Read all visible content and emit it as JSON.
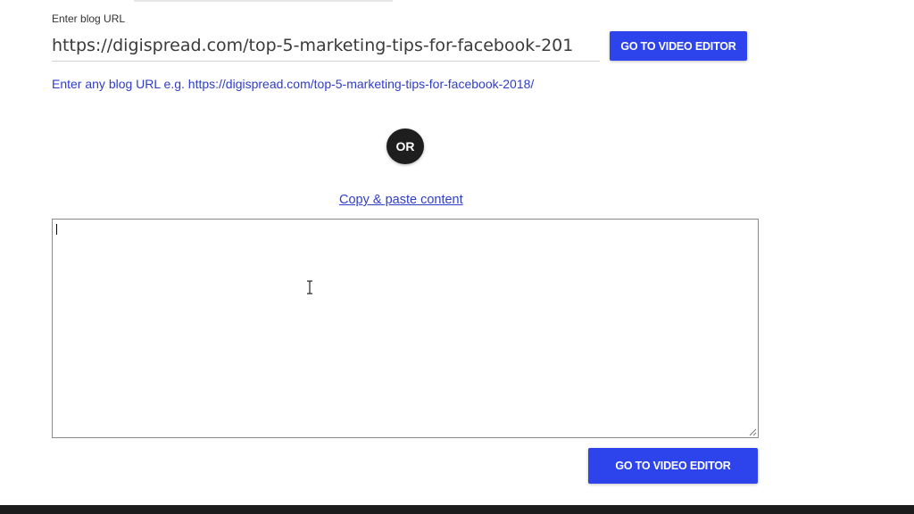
{
  "url_section": {
    "label": "Enter blog URL",
    "value": "https://digispread.com/top-5-marketing-tips-for-facebook-201",
    "button_label": "GO TO VIDEO EDITOR",
    "hint": "Enter any blog URL e.g. https://digispread.com/top-5-marketing-tips-for-facebook-2018/"
  },
  "divider": {
    "label": "OR"
  },
  "paste_section": {
    "link_label": "Copy & paste content",
    "textarea_value": "",
    "button_label": "GO TO VIDEO EDITOR"
  },
  "colors": {
    "accent": "#2d43ec",
    "link": "#2f3ec9",
    "badge": "#1e1e1e",
    "footer": "#1c1c1c"
  }
}
